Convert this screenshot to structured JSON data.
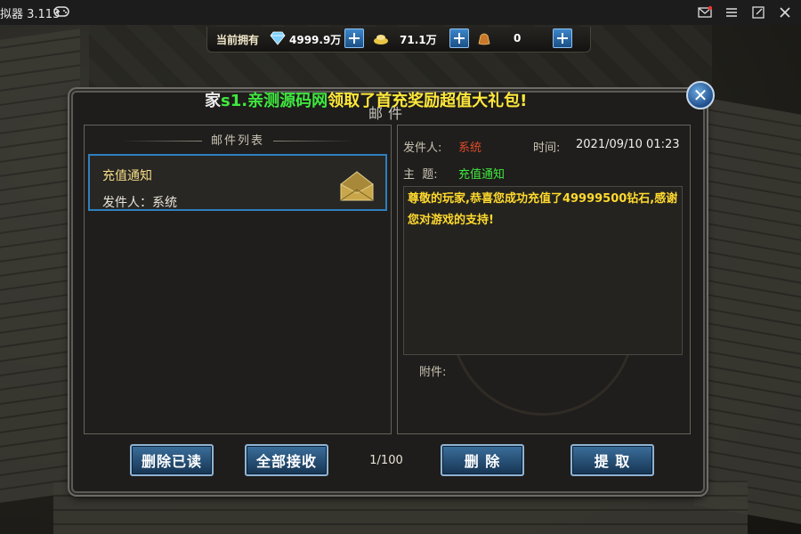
{
  "window": {
    "title": "拟器 3.113",
    "icons": [
      "gamepad-icon",
      "mail-icon",
      "menu-icon",
      "restore-icon",
      "close-window-icon"
    ]
  },
  "resources": {
    "label": "当前拥有",
    "diamond": "4999.9万",
    "gold": "71.1万",
    "bag": "0"
  },
  "announcement": {
    "lead": "家",
    "name": "s1.亲测源码网",
    "rest": "领取了首充奖励超值大礼包!"
  },
  "dialog": {
    "title": "邮件"
  },
  "mail_list": {
    "header": "邮件列表",
    "items": [
      {
        "subject": "充值通知",
        "sender": "发件人：系统"
      }
    ]
  },
  "mail_detail": {
    "sender_label": "发件人:",
    "sender": "系统",
    "time_label": "时间:",
    "time": "2021/09/10 01:23",
    "subject_label": "主  题:",
    "subject": "充值通知",
    "body": "尊敬的玩家,恭喜您成功充值了49999500钻石,感谢您对游戏的支持!",
    "attachment_label": "附件:"
  },
  "footer": {
    "delete_read": "删除已读",
    "receive_all": "全部接收",
    "page": "1/100",
    "delete": "删 除",
    "extract": "提 取"
  }
}
